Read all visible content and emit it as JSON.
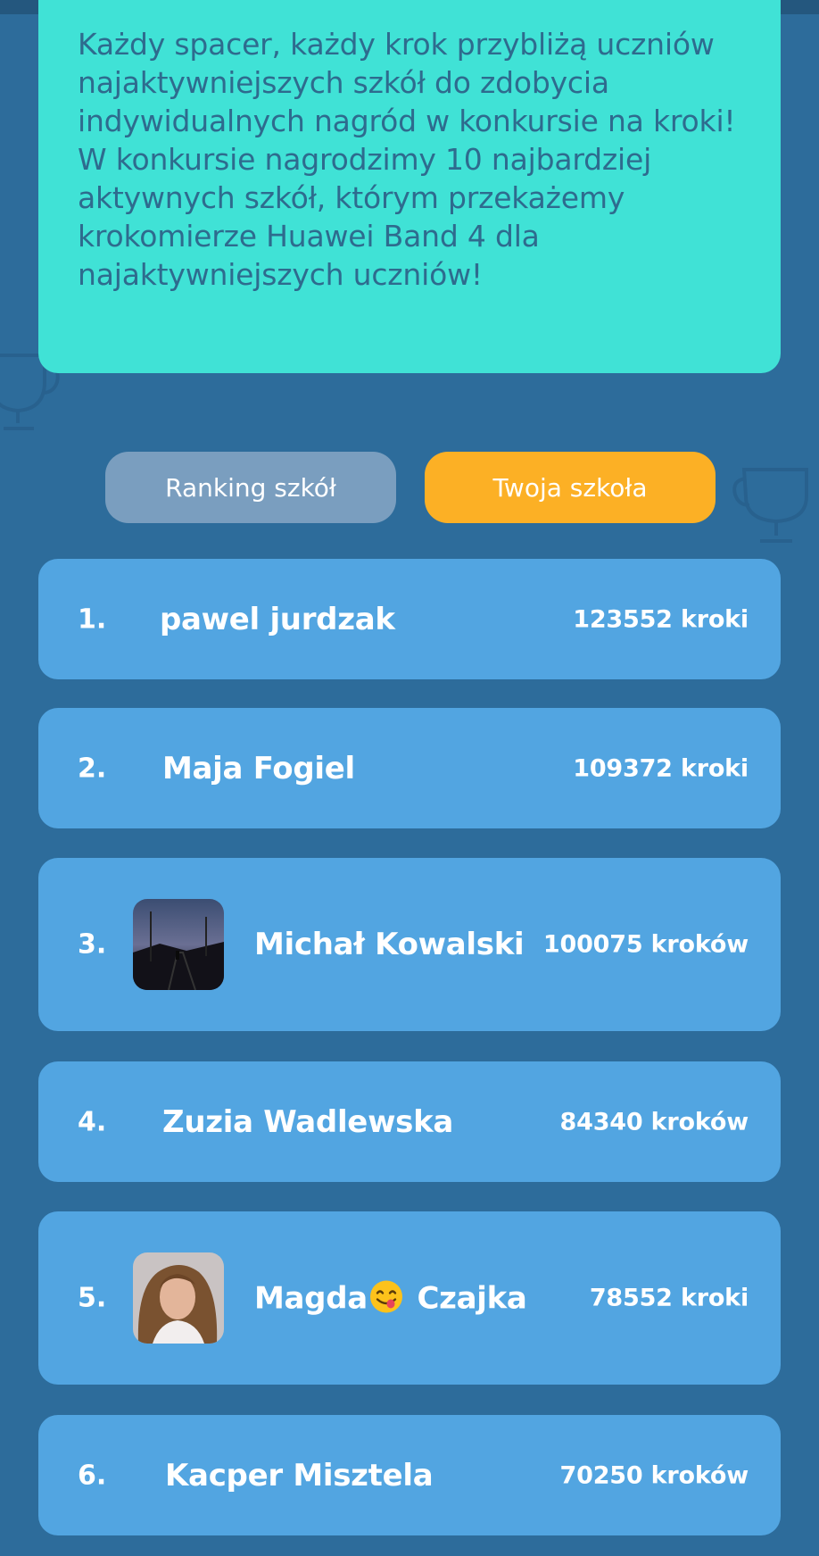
{
  "intro": {
    "text": "Każdy spacer, każdy krok przybliżą uczniów najaktywniejszych szkół do zdobycia indywidualnych nagród w konkursie na kroki! W konkursie nagrodzimy 10 najbardziej aktywnych szkół, którym przekażemy krokomierze Huawei Band 4 dla najaktywniejszych uczniów!"
  },
  "tabs": {
    "ranking_label": "Ranking szkół",
    "school_label": "Twoja szkoła"
  },
  "leaderboard": [
    {
      "rank": "1.",
      "name": "pawel jurdzak",
      "steps": "123552 kroki",
      "avatar": null
    },
    {
      "rank": "2.",
      "name": "Maja Fogiel",
      "steps": "109372 kroki",
      "avatar": null
    },
    {
      "rank": "3.",
      "name": "Michał Kowalski",
      "steps": "100075 kroków",
      "avatar": "photo-night-rails"
    },
    {
      "rank": "4.",
      "name": "Zuzia Wadlewska",
      "steps": "84340 kroków",
      "avatar": null
    },
    {
      "rank": "5.",
      "name_first": "Magda",
      "name_emoji": "face-savoring-food-emoji",
      "name_last": "Czajka",
      "steps": "78552 kroki",
      "avatar": "photo-girl-portrait"
    },
    {
      "rank": "6.",
      "name": "Kacper Misztela",
      "steps": "70250 kroków",
      "avatar": null
    }
  ],
  "colors": {
    "background": "#2d6c9b",
    "intro_card": "#40e2d6",
    "row": "#52a5e1",
    "tab_inactive": "#7a9ebf",
    "tab_active": "#fcb025"
  }
}
